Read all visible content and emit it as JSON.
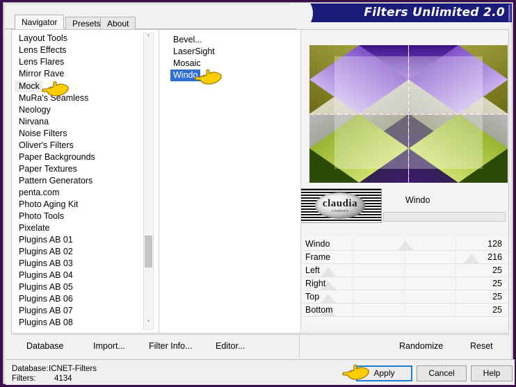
{
  "window": {
    "title": "Filters Unlimited 2.0",
    "accent_blue": "#1b1b7a",
    "selection_blue": "#2f6fd0",
    "focus_blue": "#1a7fd4"
  },
  "tabs": [
    {
      "label": "Navigator",
      "active": true
    },
    {
      "label": "Presets",
      "active": false
    },
    {
      "label": "About",
      "active": false
    }
  ],
  "categories": [
    {
      "label": "Layout Tools"
    },
    {
      "label": "Lens Effects"
    },
    {
      "label": "Lens Flares"
    },
    {
      "label": "Mirror Rave"
    },
    {
      "label": "Mock"
    },
    {
      "label": "MuRa's Seamless"
    },
    {
      "label": "Neology"
    },
    {
      "label": "Nirvana"
    },
    {
      "label": "Noise Filters"
    },
    {
      "label": "Oliver's Filters"
    },
    {
      "label": "Paper Backgrounds"
    },
    {
      "label": "Paper Textures"
    },
    {
      "label": "Pattern Generators"
    },
    {
      "label": "penta.com"
    },
    {
      "label": "Photo Aging Kit"
    },
    {
      "label": "Photo Tools"
    },
    {
      "label": "Pixelate"
    },
    {
      "label": "Plugins AB 01"
    },
    {
      "label": "Plugins AB 02"
    },
    {
      "label": "Plugins AB 03"
    },
    {
      "label": "Plugins AB 04"
    },
    {
      "label": "Plugins AB 05"
    },
    {
      "label": "Plugins AB 06"
    },
    {
      "label": "Plugins AB 07"
    },
    {
      "label": "Plugins AB 08"
    }
  ],
  "filters": [
    {
      "label": "Bevel...",
      "selected": false
    },
    {
      "label": "LaserSight",
      "selected": false
    },
    {
      "label": "Mosaic",
      "selected": false
    },
    {
      "label": "Windo",
      "selected": true
    }
  ],
  "preview": {
    "filter_name": "Windo",
    "thumbnail_logo": "claudia",
    "thumbnail_logo_sub": "creations"
  },
  "sliders": [
    {
      "label": "Windo",
      "value": "128",
      "pos": 52
    },
    {
      "label": "Frame",
      "value": "216",
      "pos": 88
    },
    {
      "label": "Left",
      "value": "25",
      "pos": 10
    },
    {
      "label": "Right",
      "value": "25",
      "pos": 10
    },
    {
      "label": "Top",
      "value": "25",
      "pos": 10
    },
    {
      "label": "Bottom",
      "value": "25",
      "pos": 10
    }
  ],
  "toolbar": {
    "database": "Database",
    "import": "Import...",
    "filter_info": "Filter Info...",
    "editor": "Editor...",
    "randomize": "Randomize",
    "reset": "Reset"
  },
  "status": {
    "database_label": "Database:",
    "database_value": "ICNET-Filters",
    "filters_label": "Filters:",
    "filters_value": "4134",
    "apply": "Apply",
    "cancel": "Cancel",
    "help": "Help"
  },
  "icons": {
    "scroll_up": "˄",
    "scroll_down": "˅"
  }
}
